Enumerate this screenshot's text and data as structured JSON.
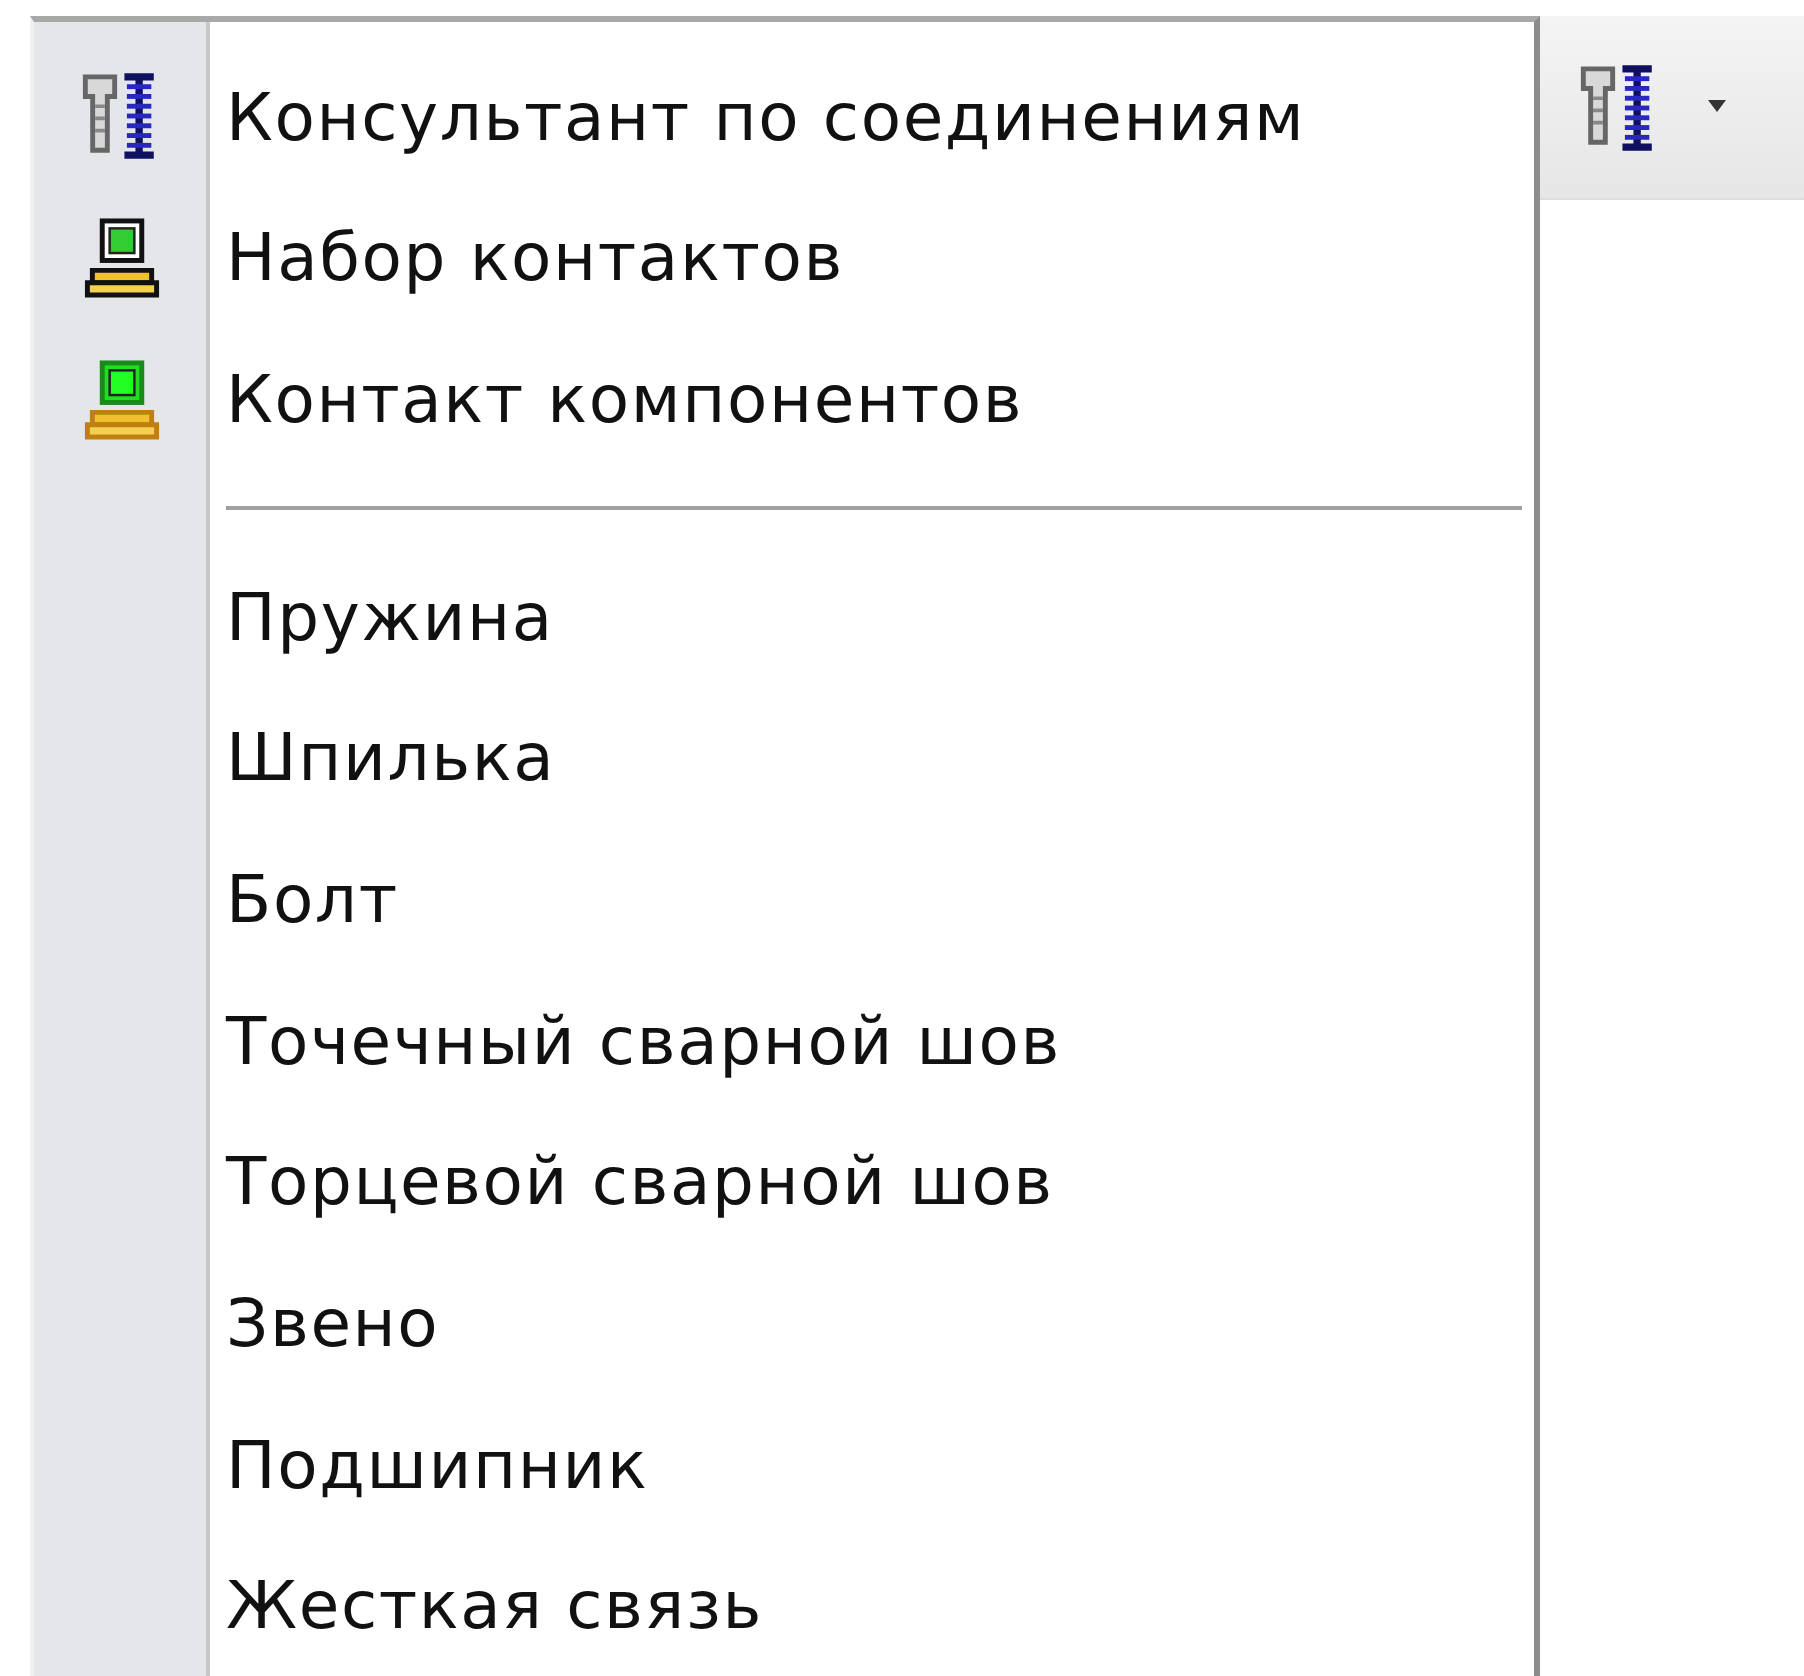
{
  "menu": {
    "items": [
      {
        "kind": "connector",
        "label": "Консультант по соединениям"
      },
      {
        "kind": "contacts",
        "label": "Набор контактов"
      },
      {
        "kind": "components",
        "label": "Контакт компонентов"
      },
      {
        "kind": "separator"
      },
      {
        "kind": "plain",
        "label": "Пружина"
      },
      {
        "kind": "plain",
        "label": "Шпилька"
      },
      {
        "kind": "plain",
        "label": "Болт"
      },
      {
        "kind": "plain",
        "label": "Точечный сварной шов"
      },
      {
        "kind": "plain",
        "label": "Торцевой сварной шов"
      },
      {
        "kind": "plain",
        "label": "Звено"
      },
      {
        "kind": "plain",
        "label": "Подшипник"
      },
      {
        "kind": "plain",
        "label": "Жесткая связь"
      }
    ]
  },
  "toolbar": {
    "button": {
      "kind": "connector",
      "has_dropdown": true
    }
  }
}
